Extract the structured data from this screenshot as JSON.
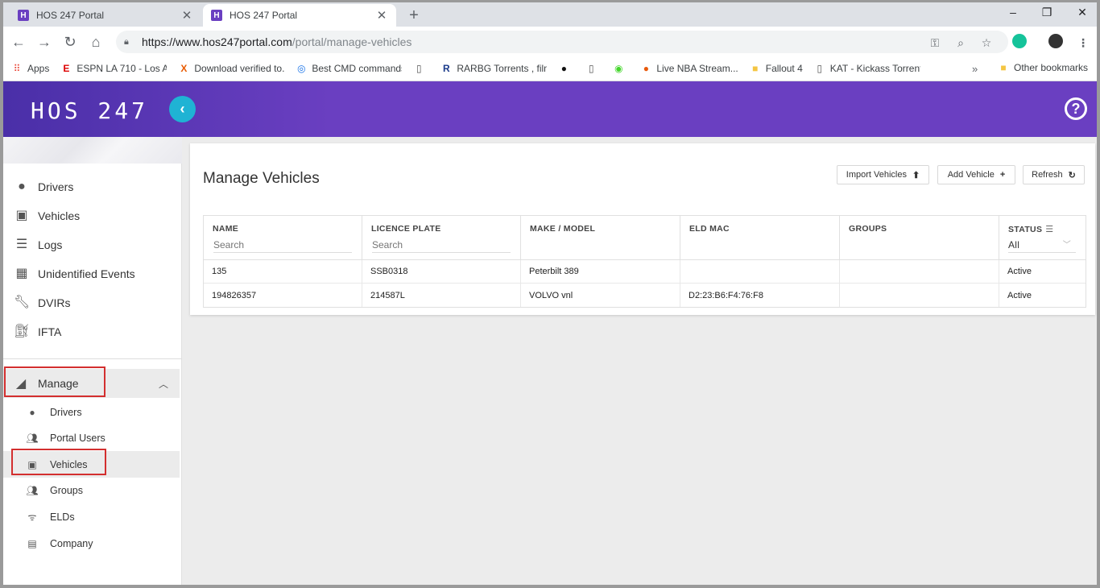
{
  "browser": {
    "tabs": [
      {
        "favicon": "H",
        "title": "HOS 247 Portal",
        "close": "✕"
      },
      {
        "favicon": "H",
        "title": "HOS 247 Portal",
        "close": "✕"
      }
    ],
    "new_tab": "+",
    "window_controls": {
      "minimize": "–",
      "restore": "❐",
      "close": "✕"
    },
    "url_host": "https://www.hos247portal.com",
    "url_path": "/portal/manage-vehicles",
    "bookmarks": [
      {
        "icon": "apps-grid-icon",
        "label": "Apps"
      },
      {
        "icon": "espn-icon",
        "label": "ESPN LA 710 - Los An..."
      },
      {
        "icon": "x-icon",
        "label": "Download verified to..."
      },
      {
        "icon": "globe-icon",
        "label": "Best CMD commands..."
      },
      {
        "icon": "page-icon",
        "label": ""
      },
      {
        "icon": "r-icon",
        "label": "RARBG Torrents , film..."
      },
      {
        "icon": "spotify-icon",
        "label": ""
      },
      {
        "icon": "page-icon",
        "label": ""
      },
      {
        "icon": "razer-icon",
        "label": ""
      },
      {
        "icon": "basketball-icon",
        "label": "Live NBA Stream..."
      },
      {
        "icon": "folder-icon",
        "label": "Fallout 4"
      },
      {
        "icon": "page-icon",
        "label": "KAT - Kickass Torrents..."
      }
    ],
    "bookmarks_more": "»",
    "other_bookmarks": "Other bookmarks"
  },
  "app": {
    "logo": "HOS 247",
    "help": "?"
  },
  "sidebar": {
    "items": [
      {
        "icon": "person-icon",
        "label": "Drivers"
      },
      {
        "icon": "bus-icon",
        "label": "Vehicles"
      },
      {
        "icon": "list-icon",
        "label": "Logs"
      },
      {
        "icon": "calendar-icon",
        "label": "Unidentified Events"
      },
      {
        "icon": "wrench-icon",
        "label": "DVIRs"
      },
      {
        "icon": "fuel-icon",
        "label": "IFTA"
      }
    ],
    "manage": {
      "icon": "manage-icon",
      "label": "Manage"
    },
    "sub_items": [
      {
        "icon": "person-icon",
        "label": "Drivers"
      },
      {
        "icon": "people-icon",
        "label": "Portal Users"
      },
      {
        "icon": "bus-icon",
        "label": "Vehicles"
      },
      {
        "icon": "group-icon",
        "label": "Groups"
      },
      {
        "icon": "eld-icon",
        "label": "ELDs"
      },
      {
        "icon": "building-icon",
        "label": "Company"
      }
    ]
  },
  "main": {
    "title": "Manage Vehicles",
    "buttons": {
      "import": "Import Vehicles",
      "add": "Add Vehicle",
      "refresh": "Refresh"
    },
    "table": {
      "headers": [
        "NAME",
        "LICENCE PLATE",
        "MAKE / MODEL",
        "ELD MAC",
        "GROUPS",
        "STATUS"
      ],
      "search_placeholder": "Search",
      "status_filter": "All",
      "rows": [
        [
          "135",
          "SSB0318",
          "Peterbilt 389",
          "",
          "",
          "Active"
        ],
        [
          "194826357",
          "214587L",
          "VOLVO vnl",
          "D2:23:B6:F4:76:F8",
          "",
          "Active"
        ]
      ]
    }
  },
  "colors": {
    "header_purple": "#6a3fc1",
    "accent_cyan": "#1fb3d4",
    "highlight_red": "#d32f2f"
  }
}
